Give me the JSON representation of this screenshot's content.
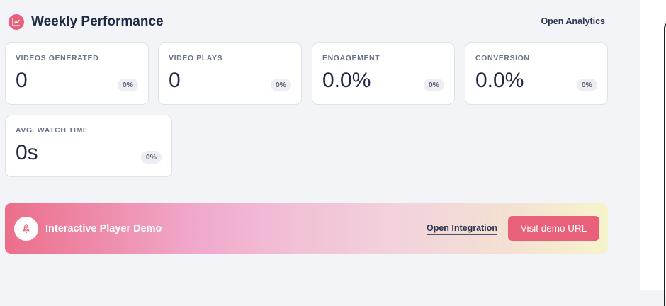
{
  "header": {
    "title": "Weekly Performance",
    "link_label": "Open Analytics",
    "icon": "chart-icon"
  },
  "metrics": [
    {
      "label": "VIDEOS GENERATED",
      "value": "0",
      "change": "0%"
    },
    {
      "label": "VIDEO PLAYS",
      "value": "0",
      "change": "0%"
    },
    {
      "label": "ENGAGEMENT",
      "value": "0.0%",
      "change": "0%"
    },
    {
      "label": "CONVERSION",
      "value": "0.0%",
      "change": "0%"
    },
    {
      "label": "AVG. WATCH TIME",
      "value": "0s",
      "change": "0%"
    }
  ],
  "banner": {
    "title": "Interactive Player Demo",
    "link_label": "Open Integration",
    "button_label": "Visit demo URL",
    "icon": "rocket-icon"
  },
  "colors": {
    "accent": "#e8607a",
    "background": "#f3f4f8",
    "text": "#1f2a44"
  }
}
